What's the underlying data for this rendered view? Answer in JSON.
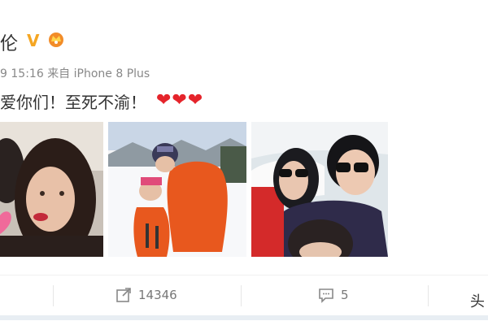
{
  "user": {
    "name_fragment": "伦",
    "verified_badge": "V",
    "crown_icon": "crown-badge-icon"
  },
  "meta": {
    "date_fragment": "9",
    "time": "15:16",
    "source_prefix": "来自",
    "device": "iPhone 8 Plus"
  },
  "post": {
    "text": "爱你们！至死不渝！",
    "hearts": "❤❤❤"
  },
  "photos": [
    {
      "description": "selfie-woman-pink-heart"
    },
    {
      "description": "ski-slope-family-orange-jacket"
    },
    {
      "description": "car-selfie-sunglasses"
    }
  ],
  "actions": {
    "repost": {
      "icon": "share-icon",
      "count": "14346"
    },
    "comment": {
      "icon": "comment-icon",
      "count": "5"
    },
    "cut_label": "头"
  },
  "colors": {
    "heart": "#e5242b",
    "badge": "#f5a623",
    "muted": "#888888"
  }
}
